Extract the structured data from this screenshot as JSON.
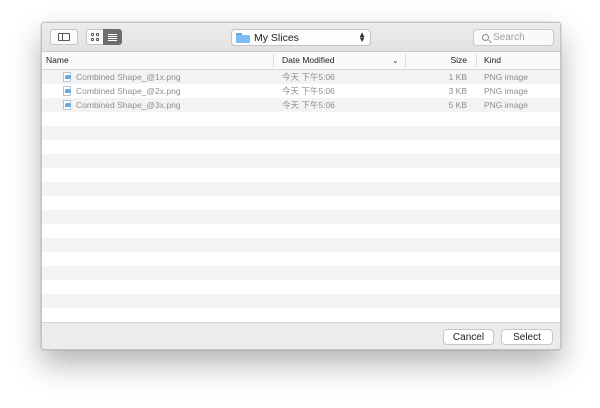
{
  "toolbar": {
    "location": "My Slices",
    "search_placeholder": "Search"
  },
  "columns": {
    "name": "Name",
    "date": "Date Modified",
    "size": "Size",
    "kind": "Kind"
  },
  "files": [
    {
      "name": "Combined Shape_@1x.png",
      "date": "今天 下午5:06",
      "size": "1 KB",
      "kind": "PNG image"
    },
    {
      "name": "Combined Shape_@2x.png",
      "date": "今天 下午5:06",
      "size": "3 KB",
      "kind": "PNG image"
    },
    {
      "name": "Combined Shape_@3x.png",
      "date": "今天 下午5:06",
      "size": "5 KB",
      "kind": "PNG image"
    }
  ],
  "buttons": {
    "cancel": "Cancel",
    "select": "Select"
  },
  "icons": {
    "sidebar": "sidebar-toggle-icon",
    "icon_view": "icon-view-icon",
    "list_view": "list-view-icon",
    "folder": "folder-icon",
    "search": "search-icon",
    "file": "png-file-icon"
  },
  "colors": {
    "folder_blue": "#7cbcf2",
    "selected_view": "#6d6d6d",
    "row_stripe": "#f3f3f3"
  }
}
